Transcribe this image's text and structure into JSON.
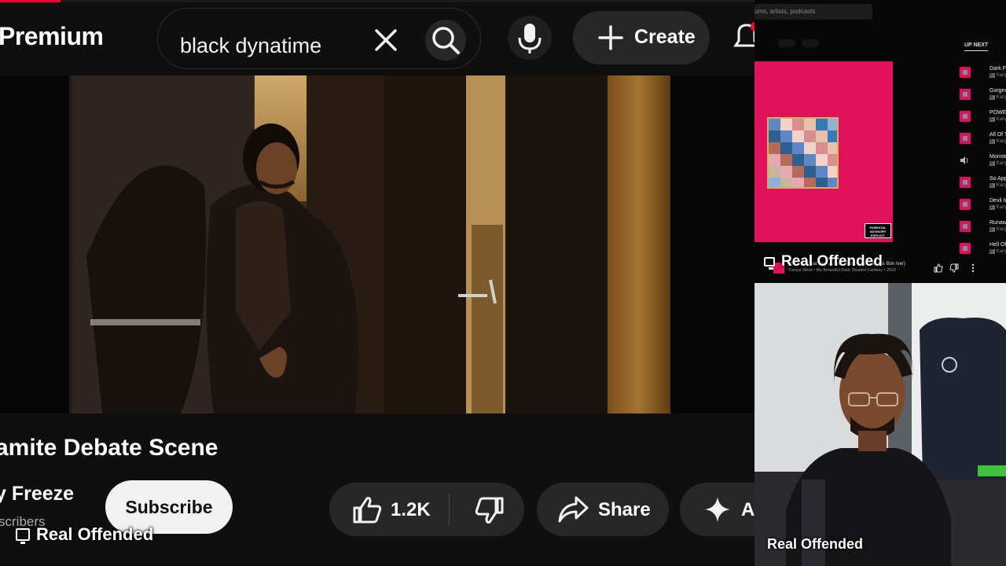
{
  "youtube": {
    "logo_text": "Premium",
    "search": {
      "query": "black dynatime"
    },
    "create_label": "Create",
    "video_title": "amite Debate Scene",
    "channel_name": "y Freeze",
    "subscribers_text": "scribers",
    "subscribe_label": "Subscribe",
    "like_count": "1.2K",
    "share_label": "Share",
    "ask_label": "A",
    "progress_fraction": 0.08,
    "accent_color": "#ff0033"
  },
  "music": {
    "search_placeholder": "ums, artists, podcasts",
    "up_next_label": "UP NEXT",
    "album_color": "#e0105a",
    "queue": [
      {
        "title": "Dark Fantas",
        "artist": "Kanye W",
        "playing": false
      },
      {
        "title": "Gorgeous (f",
        "artist": "Kanye W",
        "playing": false
      },
      {
        "title": "POWER",
        "artist": "Kanye W",
        "playing": false
      },
      {
        "title": "All Of The L",
        "artist": "Kanye W",
        "playing": false
      },
      {
        "title": "Monster (fe",
        "artist": "Kanye W",
        "playing": true
      },
      {
        "title": "So Appalled",
        "artist": "Kanye W",
        "playing": false
      },
      {
        "title": "Devil In A N",
        "artist": "Kanye W",
        "playing": false
      },
      {
        "title": "Runaway (fe",
        "artist": "Kanye W",
        "playing": false
      },
      {
        "title": "Hell Of A Lif",
        "artist": "Kanye W",
        "playing": false
      }
    ],
    "now_playing": {
      "title": "Monster (feat. Jay-Z, Rick Ross, Nicki Minaj & Bon Iver)",
      "subtitle": "Kanye West • My Beautiful Dark Twisted Fantasy • 2010"
    }
  },
  "overlays": {
    "music_source_label": "Real Offended",
    "youtube_source_label": "Real Offended",
    "cam_label": "Real Offended"
  }
}
